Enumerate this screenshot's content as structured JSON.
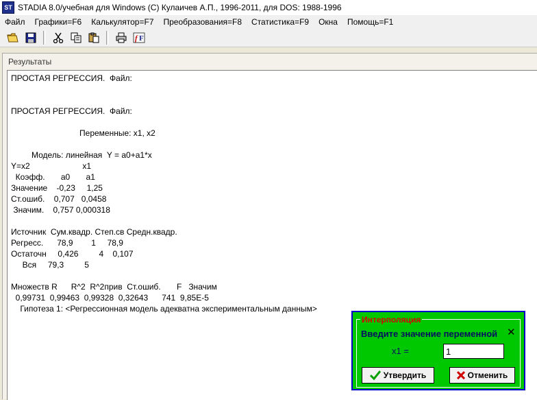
{
  "window": {
    "icon_text": "ST",
    "title": "STADIA 8.0/учебная для Windows  (С) Кулаичев А.П., 1996-2011, для DOS: 1988-1996"
  },
  "menu": [
    "Файл",
    "Графики=F6",
    "Калькулятор=F7",
    "Преобразования=F8",
    "Статистика=F9",
    "Окна",
    "Помощь=F1"
  ],
  "toolbar": {
    "buttons": [
      "open-icon",
      "save-icon",
      "cut-icon",
      "copy-icon",
      "paste-icon",
      "print-icon",
      "font-icon"
    ]
  },
  "results": {
    "window_title": "Результаты",
    "lines": [
      "ПРОСТАЯ РЕГРЕССИЯ.  Файл:",
      "",
      "",
      "ПРОСТАЯ РЕГРЕССИЯ.  Файл:",
      "",
      "                              Переменные: x1, x2",
      "",
      "         Модель: линейная  Y = a0+a1*x",
      "Y=x2                       x1",
      "  Коэфф.       a0       a1",
      "Значение    -0,23     1,25",
      "Ст.ошиб.    0,707   0,0458",
      " Значим.    0,757 0,000318",
      "",
      "Источник  Сум.квадр. Степ.св Средн.квадр.",
      "Регресс.      78,9        1     78,9",
      "Остаточн     0,426         4    0,107",
      "     Вся     79,3         5",
      "",
      "Множеств R      R^2  R^2прив  Ст.ошиб.       F   Значим",
      "  0,99731  0,99463  0,99328  0,32643      741  9,85E-5",
      "    Гипотеза 1: <Регрессионная модель адекватна экспериментальным данным>"
    ]
  },
  "dialog": {
    "title": "Интерполяция",
    "prompt": "Введите значение переменной",
    "close_symbol": "✕",
    "field_label": "x1 =",
    "field_value": "1",
    "confirm_label": "Утвердить",
    "cancel_label": "Отменить"
  },
  "colors": {
    "dialog_bg": "#00c800",
    "dialog_border": "#0000cc",
    "dialog_title": "#d80000"
  }
}
